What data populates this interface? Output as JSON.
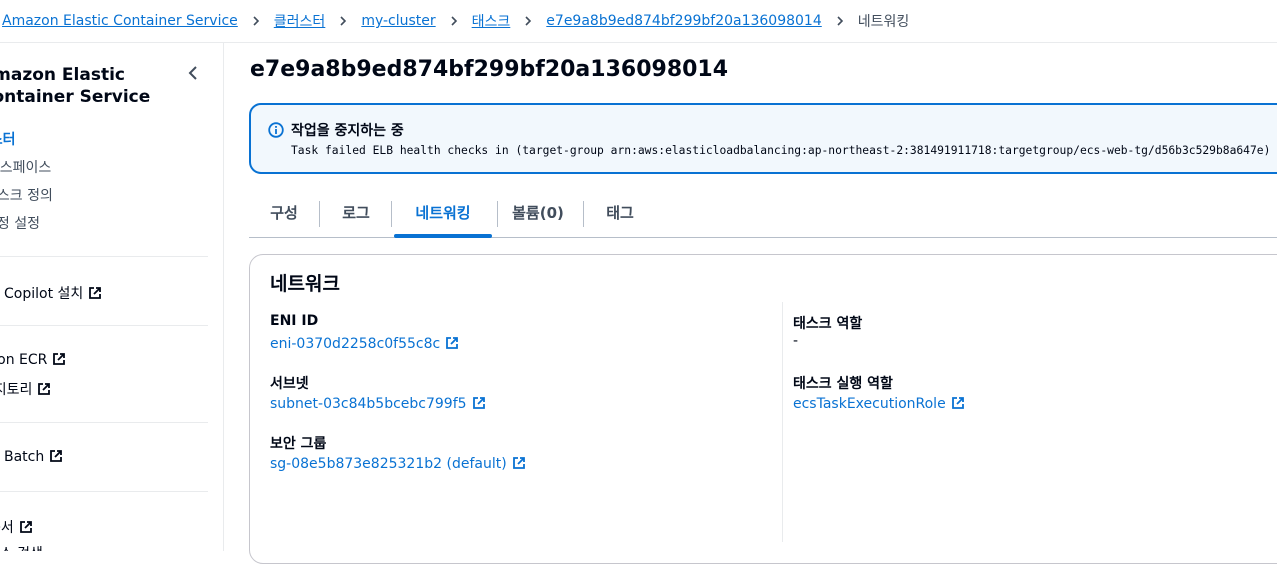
{
  "breadcrumb": {
    "items": [
      "Amazon Elastic Container Service",
      "클러스터",
      "my-cluster",
      "태스크",
      "e7e9a8b9ed874bf299bf20a136098014"
    ],
    "current": "네트워킹"
  },
  "sidebar": {
    "title": "Amazon Elastic Container Service",
    "items": [
      {
        "label": "클러스터",
        "active": true
      },
      {
        "label": "네임스페이스"
      },
      {
        "label": "태스크 정의"
      },
      {
        "label": "계정 설정"
      },
      {
        "label": "AWS Copilot 설치",
        "external": true
      },
      {
        "label": "Amazon ECR",
        "external": true
      },
      {
        "label": "리포지토리",
        "external": true
      },
      {
        "label": "AWS Batch",
        "external": true
      },
      {
        "label": "문서",
        "external": true
      },
      {
        "label": "서비스 검색"
      }
    ]
  },
  "page": {
    "title": "e7e9a8b9ed874bf299bf20a136098014"
  },
  "alert": {
    "title": "작업을 중지하는 중",
    "message": "Task failed ELB health checks in (target-group arn:aws:elasticloadbalancing:ap-northeast-2:381491911718:targetgroup/ecs-web-tg/d56b3c529b8a647e)"
  },
  "tabs": [
    "구성",
    "로그",
    "네트워킹",
    "볼륨(0)",
    "태그"
  ],
  "active_tab": "네트워킹",
  "network": {
    "heading": "네트워크",
    "eni_label": "ENI ID",
    "eni_value": "eni-0370d2258c0f55c8c",
    "subnet_label": "서브넷",
    "subnet_value": "subnet-03c84b5bcebc799f5",
    "sg_label": "보안 그룹",
    "sg_value": "sg-08e5b873e825321b2 (default)",
    "task_role_label": "태스크 역할",
    "task_role_value": "-",
    "exec_role_label": "태스크 실행 역할",
    "exec_role_value": "ecsTaskExecutionRole"
  },
  "colors": {
    "link": "#0972d3",
    "alert_bg": "#f2f8fd",
    "text": "#000716"
  }
}
